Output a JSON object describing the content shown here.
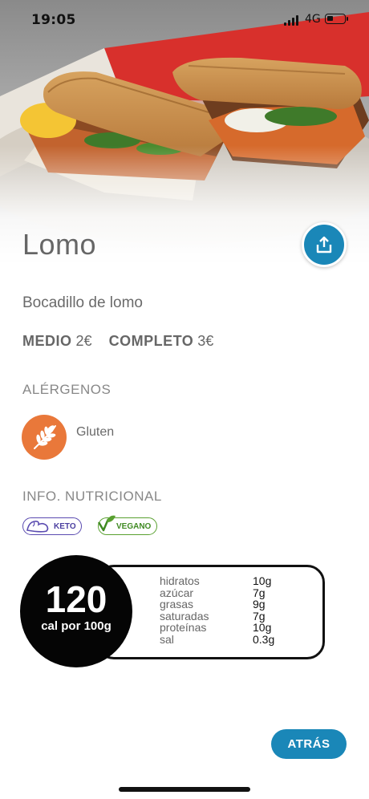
{
  "status_bar": {
    "time": "19:05",
    "network": "4G"
  },
  "product": {
    "title": "Lomo",
    "subtitle": "Bocadillo de lomo",
    "prices": [
      {
        "label": "MEDIO",
        "amount": "2€"
      },
      {
        "label": "COMPLETO",
        "amount": "3€"
      }
    ]
  },
  "allergens": {
    "heading": "ALÉRGENOS",
    "items": [
      {
        "label": "Gluten",
        "icon": "wheat-icon",
        "color": "#e9783a"
      }
    ]
  },
  "nutrition": {
    "heading": "INFO. NUTRICIONAL",
    "badges": [
      {
        "label": "KETO",
        "color": "#5a4bb0"
      },
      {
        "label": "VEGANO",
        "color": "#59a030"
      }
    ],
    "calories": "120",
    "calories_unit": "cal por 100g",
    "rows": [
      {
        "name": "hidratos",
        "value": "10g"
      },
      {
        "name": "azúcar",
        "value": "7g"
      },
      {
        "name": "grasas",
        "value": "9g"
      },
      {
        "name": "saturadas",
        "value": "7g"
      },
      {
        "name": "proteínas",
        "value": "10g"
      },
      {
        "name": "sal",
        "value": "0.3g"
      }
    ]
  },
  "actions": {
    "share_icon": "share-icon",
    "back_label": "ATRÁS"
  },
  "colors": {
    "accent": "#1a87b8",
    "allergen": "#e9783a"
  }
}
